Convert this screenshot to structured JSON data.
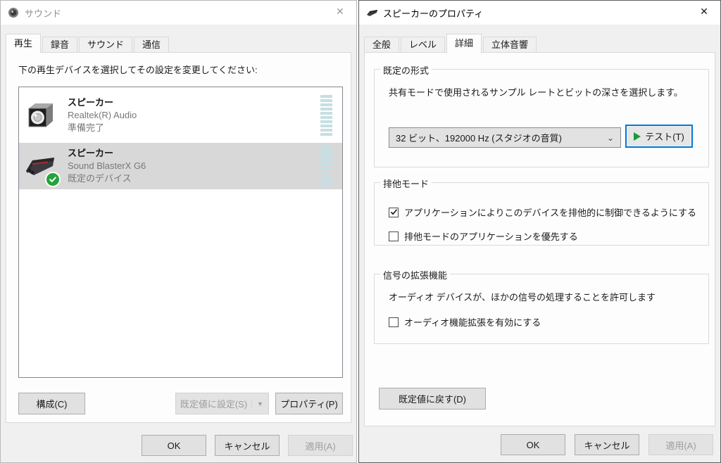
{
  "icons": {
    "close": "✕",
    "dropdown_chevron": "⌄",
    "split_arrow": "▼"
  },
  "accents": {
    "focus_blue": "#0079d8",
    "check_green": "#23a33a",
    "meter_teal": "#c6dfe3",
    "selected_row_gray": "#d8d8d8"
  },
  "left_dialog": {
    "title": "サウンド",
    "tabs": [
      {
        "label": "再生",
        "active": true
      },
      {
        "label": "録音",
        "active": false
      },
      {
        "label": "サウンド",
        "active": false
      },
      {
        "label": "通信",
        "active": false
      }
    ],
    "instruction": "下の再生デバイスを選択してその設定を変更してください:",
    "devices": [
      {
        "name": "スピーカー",
        "detail": "Realtek(R) Audio",
        "status": "準備完了",
        "selected": false,
        "is_default": false
      },
      {
        "name": "スピーカー",
        "detail": "Sound BlasterX G6",
        "status": "既定のデバイス",
        "selected": true,
        "is_default": true
      }
    ],
    "buttons": {
      "configure": "構成(C)",
      "set_default": "既定値に設定(S)",
      "properties": "プロパティ(P)"
    },
    "footer": {
      "ok": "OK",
      "cancel": "キャンセル",
      "apply": "適用(A)"
    }
  },
  "right_dialog": {
    "title": "スピーカーのプロパティ",
    "tabs": [
      {
        "label": "全般",
        "active": false
      },
      {
        "label": "レベル",
        "active": false
      },
      {
        "label": "詳細",
        "active": true
      },
      {
        "label": "立体音響",
        "active": false
      }
    ],
    "default_format": {
      "group_title": "既定の形式",
      "description": "共有モードで使用されるサンプル レートとビットの深さを選択します。",
      "selected_value": "32 ビット、192000 Hz (スタジオの音質)",
      "test_button": "テスト(T)"
    },
    "exclusive_mode": {
      "group_title": "排他モード",
      "checkbox1": {
        "label": "アプリケーションによりこのデバイスを排他的に制御できるようにする",
        "checked": true
      },
      "checkbox2": {
        "label": "排他モードのアプリケーションを優先する",
        "checked": false
      }
    },
    "signal_enhancements": {
      "group_title": "信号の拡張機能",
      "description": "オーディオ デバイスが、ほかの信号の処理することを許可します",
      "checkbox": {
        "label": "オーディオ機能拡張を有効にする",
        "checked": false
      }
    },
    "restore_defaults": "既定値に戻す(D)",
    "footer": {
      "ok": "OK",
      "cancel": "キャンセル",
      "apply": "適用(A)"
    }
  }
}
